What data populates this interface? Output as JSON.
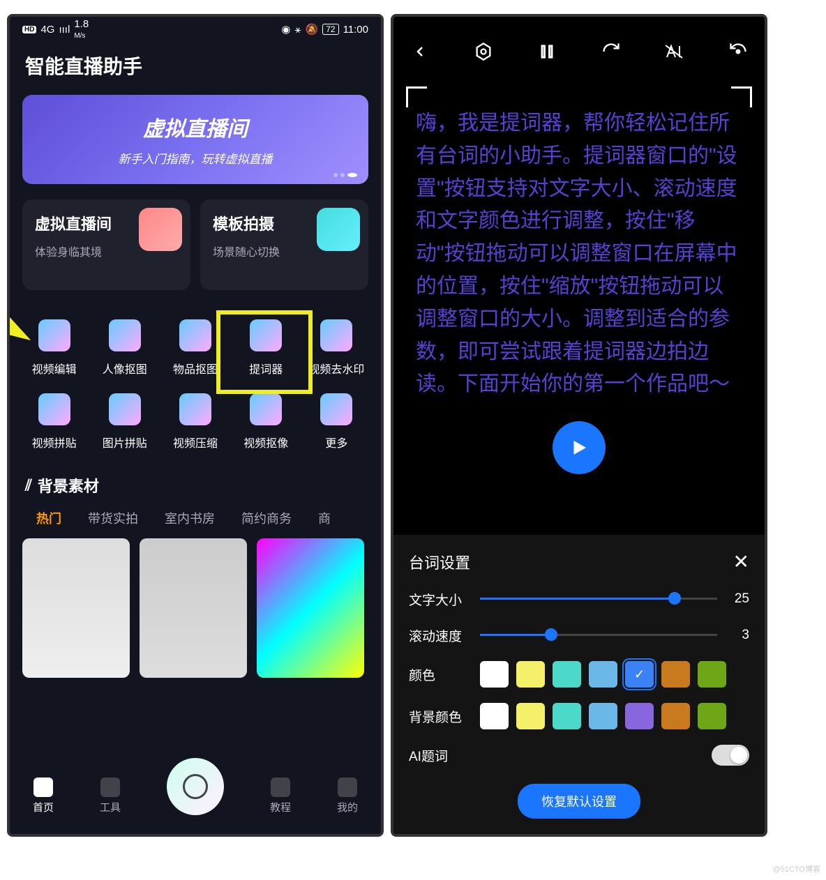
{
  "status": {
    "hd": "HD",
    "net": "4G",
    "speed": "1.8",
    "speed_unit": "M/s",
    "battery": "72",
    "time": "11:00"
  },
  "app_title": "智能直播助手",
  "banner": {
    "title": "虚拟直播间",
    "subtitle": "新手入门指南，玩转虚拟直播"
  },
  "cards": [
    {
      "title": "虚拟直播间",
      "subtitle": "体验身临其境"
    },
    {
      "title": "模板拍摄",
      "subtitle": "场景随心切换"
    }
  ],
  "tools": [
    {
      "label": "视频编辑"
    },
    {
      "label": "人像抠图"
    },
    {
      "label": "物品抠图"
    },
    {
      "label": "提词器"
    },
    {
      "label": "视频去水印"
    },
    {
      "label": "视频拼贴"
    },
    {
      "label": "图片拼贴"
    },
    {
      "label": "视频压缩"
    },
    {
      "label": "视频抠像"
    },
    {
      "label": "更多"
    }
  ],
  "section": "背景素材",
  "tabs": [
    "热门",
    "带货实拍",
    "室内书房",
    "简约商务",
    "商"
  ],
  "nav": [
    "首页",
    "工具",
    "教程",
    "我的"
  ],
  "prompt_text": "嗨，我是提词器，帮你轻松记住所有台词的小助手。提词器窗口的\"设置\"按钮支持对文字大小、滚动速度和文字颜色进行调整，按住\"移动\"按钮拖动可以调整窗口在屏幕中的位置，按住\"缩放\"按钮拖动可以调整窗口的大小。调整到适合的参数，即可尝试跟着提词器边拍边读。下面开始你的第一个作品吧～",
  "sheet": {
    "title": "台词设置",
    "font_size": {
      "label": "文字大小",
      "value": "25"
    },
    "scroll_speed": {
      "label": "滚动速度",
      "value": "3"
    },
    "color_label": "颜色",
    "bg_label": "背景颜色",
    "ai_label": "AI题词",
    "reset": "恢复默认设置",
    "colors": [
      "#ffffff",
      "#f5f069",
      "#4dd9c9",
      "#6bb8e8",
      "#3b82f6",
      "#c97a1e",
      "#6fa617"
    ],
    "bg_colors": [
      "#ffffff",
      "#f5f069",
      "#4dd9c9",
      "#6bb8e8",
      "#8866dd",
      "#c97a1e",
      "#6fa617"
    ]
  },
  "watermark": "@51CTO博客"
}
